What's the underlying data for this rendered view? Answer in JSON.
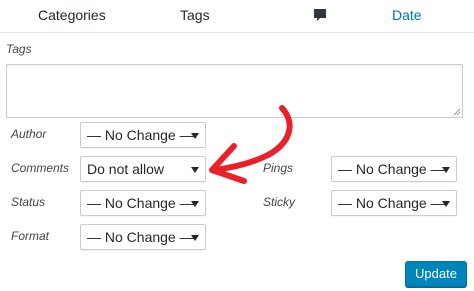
{
  "columns": {
    "categories": "Categories",
    "tags": "Tags",
    "comments_icon": "comment-bubble-icon",
    "date": "Date"
  },
  "tags": {
    "label": "Tags",
    "value": ""
  },
  "fields": {
    "author": {
      "label": "Author",
      "value": "— No Change —"
    },
    "comments": {
      "label": "Comments",
      "value": "Do not allow"
    },
    "pings": {
      "label": "Pings",
      "value": "— No Change —"
    },
    "status": {
      "label": "Status",
      "value": "— No Change —"
    },
    "sticky": {
      "label": "Sticky",
      "value": "— No Change —"
    },
    "format": {
      "label": "Format",
      "value": "— No Change —"
    }
  },
  "update_label": "Update",
  "colors": {
    "accent": "#0085ba",
    "link": "#0073aa",
    "annotation_arrow": "#e8212a"
  }
}
